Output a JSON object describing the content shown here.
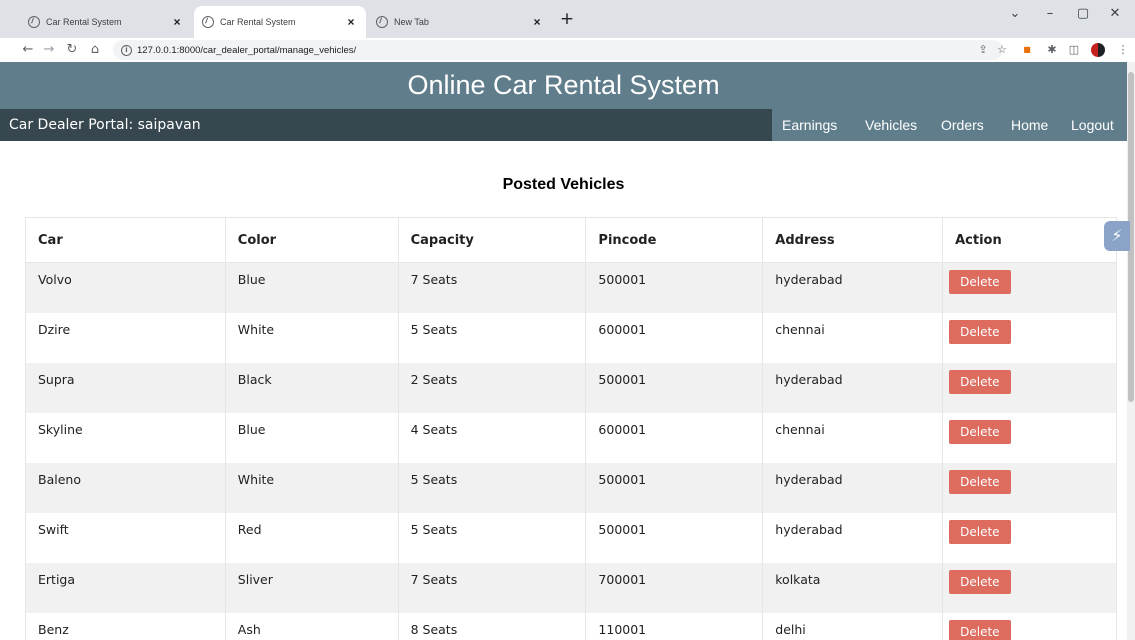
{
  "browser": {
    "tabs": [
      {
        "title": "Car Rental System"
      },
      {
        "title": "Car Rental System"
      },
      {
        "title": "New Tab"
      }
    ],
    "url": "127.0.0.1:8000/car_dealer_portal/manage_vehicles/"
  },
  "header": {
    "site_title": "Online Car Rental System",
    "portal_label": "Car Dealer Portal: saipavan",
    "nav": [
      "Earnings",
      "Vehicles",
      "Orders",
      "Home",
      "Logout"
    ]
  },
  "main": {
    "section_title": "Posted Vehicles",
    "columns": [
      "Car",
      "Color",
      "Capacity",
      "Pincode",
      "Address",
      "Action"
    ],
    "rows": [
      {
        "car": "Volvo",
        "color": "Blue",
        "capacity": "7 Seats",
        "pincode": "500001",
        "address": "hyderabad",
        "action": "Delete"
      },
      {
        "car": "Dzire",
        "color": "White",
        "capacity": "5 Seats",
        "pincode": "600001",
        "address": "chennai",
        "action": "Delete"
      },
      {
        "car": "Supra",
        "color": "Black",
        "capacity": "2 Seats",
        "pincode": "500001",
        "address": "hyderabad",
        "action": "Delete"
      },
      {
        "car": "Skyline",
        "color": "Blue",
        "capacity": "4 Seats",
        "pincode": "600001",
        "address": "chennai",
        "action": "Delete"
      },
      {
        "car": "Baleno",
        "color": "White",
        "capacity": "5 Seats",
        "pincode": "500001",
        "address": "hyderabad",
        "action": "Delete"
      },
      {
        "car": "Swift",
        "color": "Red",
        "capacity": "5 Seats",
        "pincode": "500001",
        "address": "hyderabad",
        "action": "Delete"
      },
      {
        "car": "Ertiga",
        "color": "Sliver",
        "capacity": "7 Seats",
        "pincode": "700001",
        "address": "kolkata",
        "action": "Delete"
      },
      {
        "car": "Benz",
        "color": "Ash",
        "capacity": "8 Seats",
        "pincode": "110001",
        "address": "delhi",
        "action": "Delete"
      }
    ]
  },
  "colors": {
    "header_bg": "#607d8b",
    "nav_bg": "#37474f",
    "delete_button": "#dd6b5e",
    "row_stripe": "#f1f1f1"
  },
  "icons": [
    "globe-icon",
    "close-icon",
    "plus-icon",
    "back-icon",
    "forward-icon",
    "reload-icon",
    "home-icon",
    "info-icon",
    "share-icon",
    "star-icon",
    "puzzle-icon",
    "sidepanel-icon",
    "profile-icon",
    "menu-icon",
    "minimize-icon",
    "maximize-icon",
    "window-close-icon",
    "extension-float-icon"
  ]
}
